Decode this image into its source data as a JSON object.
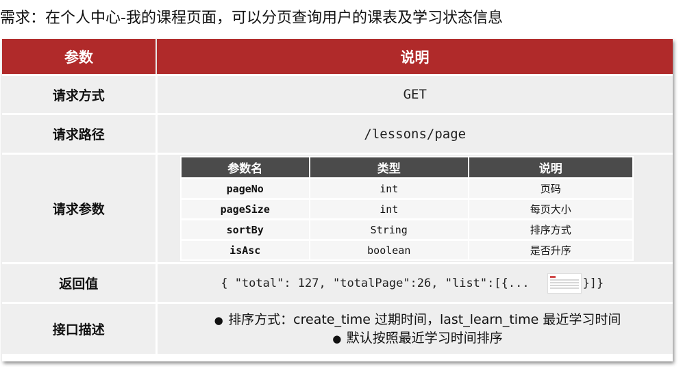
{
  "title": "需求：在个人中心-我的课程页面，可以分页查询用户的课表及学习状态信息",
  "header": {
    "param": "参数",
    "desc": "说明"
  },
  "rows": {
    "method": {
      "label": "请求方式",
      "value": "GET"
    },
    "path": {
      "label": "请求路径",
      "value": "/lessons/page"
    },
    "params": {
      "label": "请求参数",
      "headers": [
        "参数名",
        "类型",
        "说明"
      ],
      "items": [
        {
          "name": "pageNo",
          "type": "int",
          "desc": "页码"
        },
        {
          "name": "pageSize",
          "type": "int",
          "desc": "每页大小"
        },
        {
          "name": "sortBy",
          "type": "String",
          "desc": "排序方式"
        },
        {
          "name": "isAsc",
          "type": "boolean",
          "desc": "是否升序"
        }
      ]
    },
    "ret": {
      "label": "返回值",
      "prefix": "{ \"total\": 127, \"totalPage\":26, \"list\":[{...",
      "suffix": "}]}"
    },
    "desc": {
      "label": "接口描述",
      "bullets": [
        "排序方式：create_time 过期时间，last_learn_time 最近学习时间",
        "默认按照最近学习时间排序"
      ]
    }
  },
  "colors": {
    "header_bg": "#b02a2a",
    "subheader_bg": "#4b4b4b",
    "cell_bg": "#eeeeee"
  },
  "icons": {
    "bullet": "●",
    "thumbnail": "document-thumbnail-icon"
  }
}
